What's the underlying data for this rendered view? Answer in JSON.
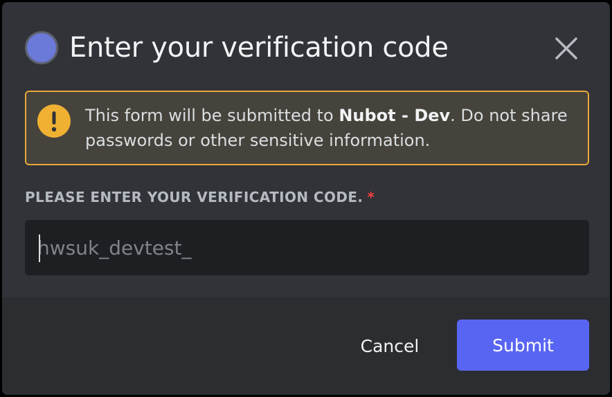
{
  "modal": {
    "title": "Enter your verification code",
    "avatar_icon": "app-avatar",
    "close_icon": "close-icon"
  },
  "warning": {
    "icon": "exclamation-icon",
    "text_prefix": "This form will be submitted to ",
    "app_name": "Nubot - Dev",
    "text_suffix": ". Do not share passwords or other sensitive information.",
    "colors": {
      "border": "#e8a93a",
      "background": "#46433c"
    }
  },
  "field": {
    "label": "PLEASE ENTER YOUR VERIFICATION CODE.",
    "required_mark": "*",
    "placeholder": "hwsuk_devtest_",
    "value": ""
  },
  "footer": {
    "cancel_label": "Cancel",
    "submit_label": "Submit"
  },
  "colors": {
    "accent": "#5865f2",
    "danger": "#f23f42",
    "modal_bg": "#313338",
    "footer_bg": "#2b2d31"
  }
}
